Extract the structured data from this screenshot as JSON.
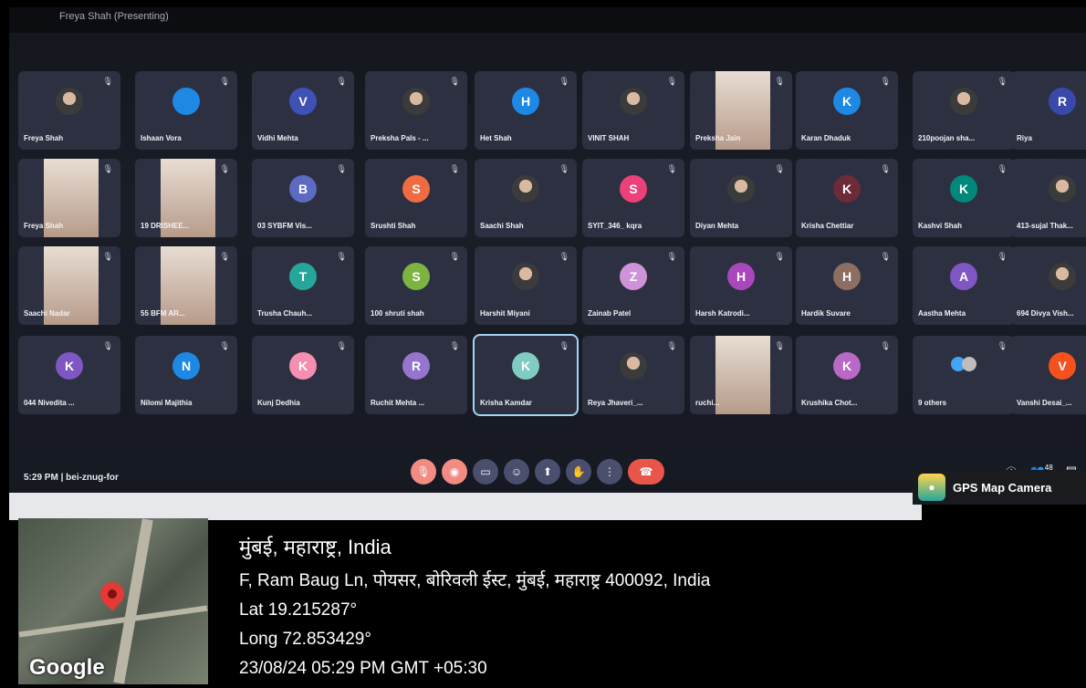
{
  "window": {
    "title": "Freya Shah (Presenting)"
  },
  "tiles": [
    {
      "name": "Freya Shah",
      "type": "photo",
      "col": 0,
      "row": 0
    },
    {
      "name": "Ishaan Vora",
      "type": "avatar",
      "letter": "",
      "color": "#1e88e5",
      "col": 1,
      "row": 0
    },
    {
      "name": "Vidhi Mehta",
      "type": "avatar",
      "letter": "V",
      "color": "#3f51b5",
      "col": 2,
      "row": 0
    },
    {
      "name": "Preksha Pals - ...",
      "type": "photo",
      "col": 3,
      "row": 0
    },
    {
      "name": "Het Shah",
      "type": "avatar",
      "letter": "H",
      "color": "#1e88e5",
      "col": 4,
      "row": 0
    },
    {
      "name": "VINIT SHAH",
      "type": "photo",
      "col": 5,
      "row": 0
    },
    {
      "name": "Preksha Jain",
      "type": "video",
      "col": 6,
      "row": 0
    },
    {
      "name": "Karan Dhaduk",
      "type": "avatar",
      "letter": "K",
      "color": "#1e88e5",
      "col": 7,
      "row": 0
    },
    {
      "name": "210poojan sha...",
      "type": "photo",
      "col": 8,
      "row": 0
    },
    {
      "name": "Riya",
      "type": "avatar",
      "letter": "R",
      "color": "#3949ab",
      "col": 9,
      "row": 0
    },
    {
      "name": "Freya Shah",
      "type": "video",
      "col": 0,
      "row": 1
    },
    {
      "name": "19 DRISHEE...",
      "type": "video",
      "col": 1,
      "row": 1
    },
    {
      "name": "03 SYBFM Vis...",
      "type": "avatar",
      "letter": "B",
      "color": "#5c6bc0",
      "col": 2,
      "row": 1
    },
    {
      "name": "Srushti Shah",
      "type": "avatar",
      "letter": "S",
      "color": "#ef6c42",
      "col": 3,
      "row": 1
    },
    {
      "name": "Saachi Shah",
      "type": "photo",
      "col": 4,
      "row": 1
    },
    {
      "name": "SYIT_346_ kqra",
      "type": "avatar",
      "letter": "S",
      "color": "#ec407a",
      "col": 5,
      "row": 1
    },
    {
      "name": "Diyan Mehta",
      "type": "photo",
      "col": 6,
      "row": 1
    },
    {
      "name": "Krisha Chettiar",
      "type": "avatar",
      "letter": "K",
      "color": "#6d2b3a",
      "col": 7,
      "row": 1
    },
    {
      "name": "Kashvi Shah",
      "type": "avatar",
      "letter": "K",
      "color": "#00897b",
      "col": 8,
      "row": 1
    },
    {
      "name": "413-sujal Thak...",
      "type": "photo",
      "col": 9,
      "row": 1
    },
    {
      "name": "Saachi Nadar",
      "type": "video",
      "col": 0,
      "row": 2
    },
    {
      "name": "55 BFM AR...",
      "type": "video",
      "col": 1,
      "row": 2
    },
    {
      "name": "Trusha Chauh...",
      "type": "avatar",
      "letter": "T",
      "color": "#26a69a",
      "col": 2,
      "row": 2
    },
    {
      "name": "100 shruti shah",
      "type": "avatar",
      "letter": "S",
      "color": "#7cb342",
      "col": 3,
      "row": 2
    },
    {
      "name": "Harshit Miyani",
      "type": "photo",
      "col": 4,
      "row": 2
    },
    {
      "name": "Zainab Patel",
      "type": "avatar",
      "letter": "Z",
      "color": "#ce93d8",
      "col": 5,
      "row": 2
    },
    {
      "name": "Harsh Katrodi...",
      "type": "avatar",
      "letter": "H",
      "color": "#ab47bc",
      "col": 6,
      "row": 2
    },
    {
      "name": "Hardik Suvare",
      "type": "avatar",
      "letter": "H",
      "color": "#8d6e63",
      "col": 7,
      "row": 2
    },
    {
      "name": "Aastha Mehta",
      "type": "avatar",
      "letter": "A",
      "color": "#7e57c2",
      "col": 8,
      "row": 2
    },
    {
      "name": "694 Divya Vish...",
      "type": "photo",
      "col": 9,
      "row": 2
    },
    {
      "name": "044 Nivedita ...",
      "type": "avatar",
      "letter": "K",
      "color": "#7e57c2",
      "col": 0,
      "row": 3
    },
    {
      "name": "Nilomi Majithia",
      "type": "avatar",
      "letter": "N",
      "color": "#1e88e5",
      "col": 1,
      "row": 3
    },
    {
      "name": "Kunj Dedhia",
      "type": "avatar",
      "letter": "K",
      "color": "#f48fb1",
      "col": 2,
      "row": 3
    },
    {
      "name": "Ruchit Mehta ...",
      "type": "avatar",
      "letter": "R",
      "color": "#9575cd",
      "col": 3,
      "row": 3
    },
    {
      "name": "Krisha Kamdar",
      "type": "avatar",
      "letter": "K",
      "color": "#80cbc4",
      "col": 4,
      "row": 3,
      "active": true
    },
    {
      "name": "Reya Jhaveri_...",
      "type": "photo",
      "col": 5,
      "row": 3
    },
    {
      "name": "ruchi...",
      "type": "video",
      "col": 6,
      "row": 3
    },
    {
      "name": "Krushika Chot...",
      "type": "avatar",
      "letter": "K",
      "color": "#ba68c8",
      "col": 7,
      "row": 3
    },
    {
      "name": "9 others",
      "type": "others",
      "col": 8,
      "row": 3
    },
    {
      "name": "Vanshi Desai_...",
      "type": "avatar",
      "letter": "V",
      "color": "#f4511e",
      "col": 9,
      "row": 3
    }
  ],
  "meeting": {
    "time": "5:29 PM",
    "code": "bei-znug-for",
    "participants_badge": "48"
  },
  "gps": {
    "app_label": "GPS Map Camera"
  },
  "location": {
    "city": "मुंबई, महाराष्ट्र, India",
    "address": "F, Ram Baug Ln, पोयसर, बोरिवली ईस्ट, मुंबई, महाराष्ट्र 400092, India",
    "lat": "Lat 19.215287°",
    "long": "Long 72.853429°",
    "datetime": "23/08/24 05:29 PM GMT +05:30",
    "map_brand": "Google"
  }
}
